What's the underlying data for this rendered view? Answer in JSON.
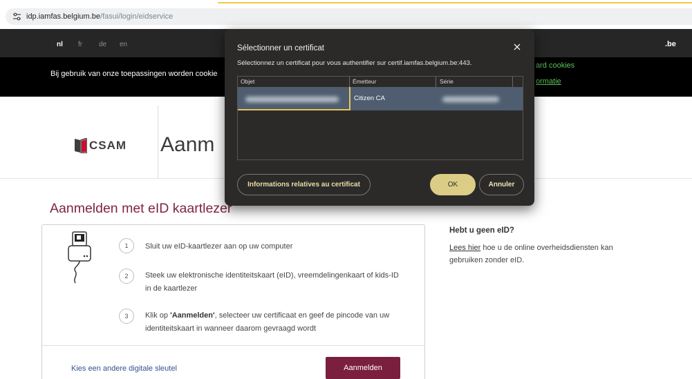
{
  "browser": {
    "site_icon": "site-settings-icon",
    "url_host": "idp.iamfas.belgium.be",
    "url_path": "/fasui/login/eidservice"
  },
  "lang_bar": {
    "languages": [
      {
        "code": "nl",
        "active": true
      },
      {
        "code": "fr",
        "active": false
      },
      {
        "code": "de",
        "active": false
      },
      {
        "code": "en",
        "active": false
      }
    ],
    "domain": ".be"
  },
  "cookie_banner": {
    "text": "Bij gebruik van onze toepassingen worden cookie",
    "link_cookies": "ard cookies",
    "link_info": "ormatie"
  },
  "header": {
    "logo_icon": "csam-logo-icon",
    "logo_text": "CSAM",
    "title": "Aanm"
  },
  "main": {
    "heading": "Aanmelden met eID kaartlezer",
    "reader_icon": "card-reader-icon",
    "steps": [
      {
        "number": "1",
        "lines": [
          "Sluit uw eID-kaartlezer aan op uw computer"
        ]
      },
      {
        "number": "2",
        "lines": [
          "Steek uw elektronische identiteitskaart (eID), vreemdelingenkaart of kids-ID",
          "in de kaartlezer"
        ]
      },
      {
        "number": "3",
        "line1_prefix": "Klik op ",
        "line1_bold": "'Aanmelden'",
        "line1_suffix": ", selecteer uw certificaat en geef de pincode van uw",
        "line2": "identiteitskaart in wanneer daarom gevraagd wordt"
      }
    ],
    "alt_key_link": "Kies een andere digitale sleutel",
    "login_button": "Aanmelden"
  },
  "aside": {
    "title": "Hebt u geen eID?",
    "link": "Lees hier",
    "line1_rest": " hoe u de online overheidsdiensten kan",
    "line2": "gebruiken zonder eID."
  },
  "dialog": {
    "title": "Sélectionner un certificat",
    "subtitle": "Sélectionnez un certificat pour vous authentifier sur certif.iamfas.belgium.be:443.",
    "close_icon": "close-icon",
    "columns": [
      "Objet",
      "Émetteur",
      "Série"
    ],
    "rows": [
      {
        "emetteur": "Citizen CA",
        "selected": true
      }
    ],
    "info_button": "Informations relatives au certificat",
    "ok_button": "OK",
    "cancel_button": "Annuler"
  },
  "colors": {
    "brand_maroon": "#7b1f3f",
    "heading_maroon": "#7f2345",
    "cookie_link_green": "#5cc05c",
    "link_blue": "#34508f",
    "dialog_background": "#2c2a29",
    "dialog_ok": "#dccd86",
    "selected_row": "#4e5d6f",
    "focus_outline": "#e8c35a"
  }
}
